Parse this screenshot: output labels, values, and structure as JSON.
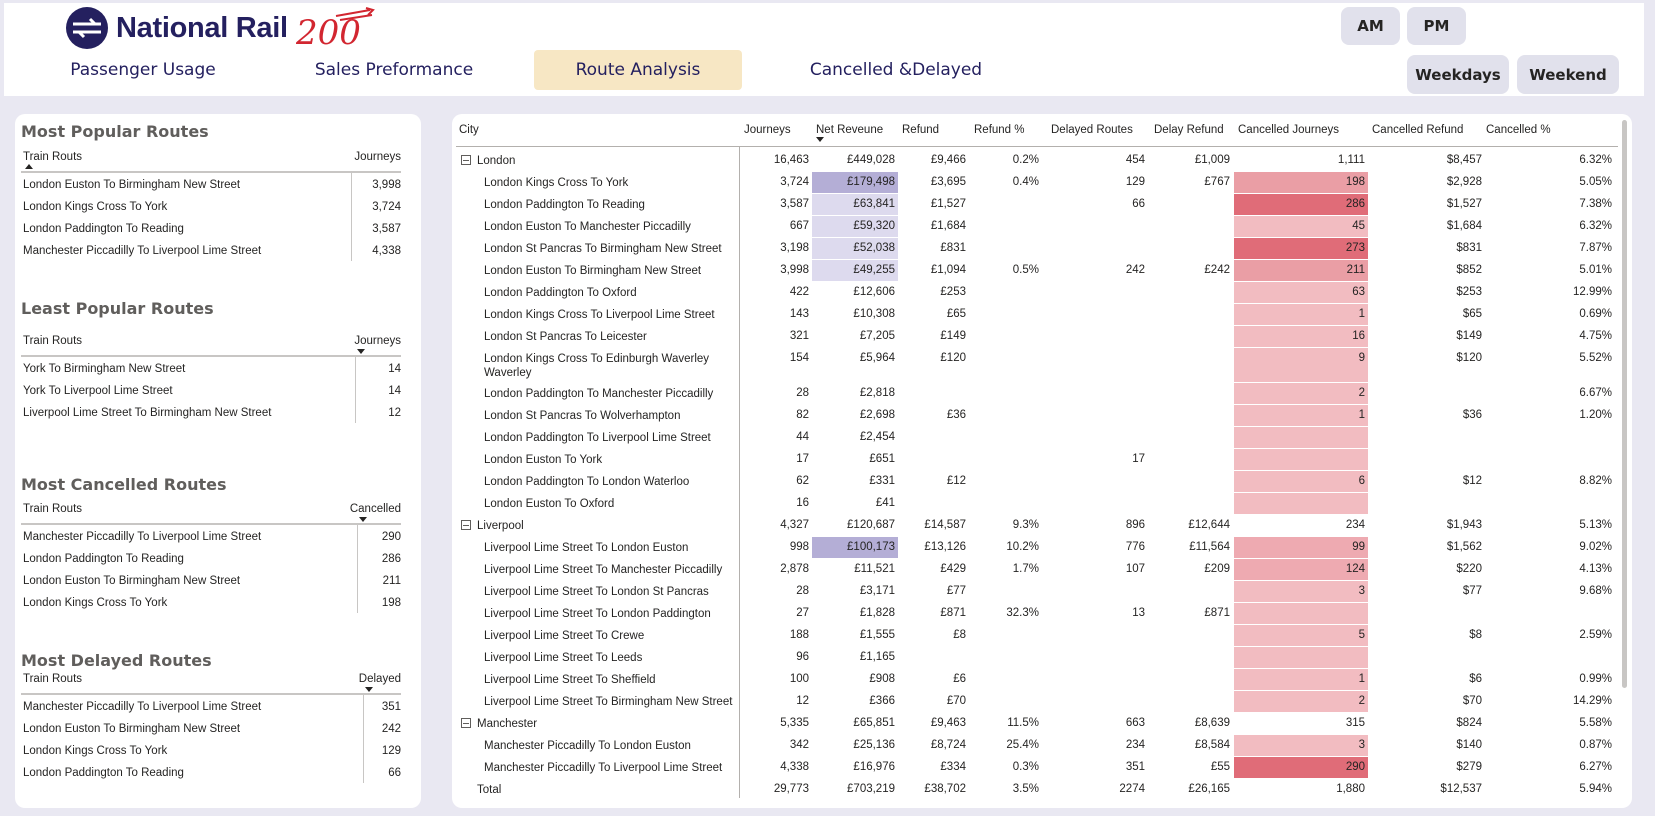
{
  "brand": {
    "name": "National Rail",
    "anniversary": "200"
  },
  "nav": {
    "tabs": [
      {
        "label": "Passenger Usage"
      },
      {
        "label": "Sales Preformance"
      },
      {
        "label": "Route Analysis"
      },
      {
        "label": "Cancelled &Delayed"
      }
    ],
    "active_tab": "Route Analysis"
  },
  "filters": {
    "am": "AM",
    "pm": "PM",
    "weekdays": "Weekdays",
    "weekend": "Weekend"
  },
  "colors": {
    "accent_tab": "#f7e7c4",
    "brand": "#24205f",
    "revenue_highlight": "#b4aed6",
    "cancelled_highlight": "#e06c78"
  },
  "left": {
    "popular": {
      "title": "Most Popular Routes",
      "col1": "Train Routs",
      "col2": "Journeys",
      "rows": [
        {
          "route": "London Euston To Birmingham New Street",
          "value": "3,998"
        },
        {
          "route": "London Kings Cross To York",
          "value": "3,724"
        },
        {
          "route": "London Paddington To Reading",
          "value": "3,587"
        },
        {
          "route": "Manchester Piccadilly To Liverpool Lime Street",
          "value": "4,338"
        }
      ]
    },
    "least": {
      "title": "Least Popular Routes",
      "col1": "Train Routs",
      "col2": "Journeys",
      "rows": [
        {
          "route": "York To Birmingham New Street",
          "value": "14"
        },
        {
          "route": "York To Liverpool Lime Street",
          "value": "14"
        },
        {
          "route": "Liverpool Lime Street To Birmingham New Street",
          "value": "12"
        }
      ]
    },
    "cancelled": {
      "title": "Most Cancelled Routes",
      "col1": "Train Routs",
      "col2": "Cancelled",
      "rows": [
        {
          "route": "Manchester Piccadilly To Liverpool Lime Street",
          "value": "290"
        },
        {
          "route": "London Paddington To Reading",
          "value": "286"
        },
        {
          "route": "London Euston To Birmingham New Street",
          "value": "211"
        },
        {
          "route": "London Kings Cross To York",
          "value": "198"
        }
      ]
    },
    "delayed": {
      "title": "Most Delayed Routes",
      "col1": "Train Routs",
      "col2": "Delayed",
      "rows": [
        {
          "route": "Manchester Piccadilly To Liverpool Lime Street",
          "value": "351"
        },
        {
          "route": "London Euston To Birmingham New Street",
          "value": "242"
        },
        {
          "route": "London Kings Cross To York",
          "value": "129"
        },
        {
          "route": "London Paddington To Reading",
          "value": "66"
        }
      ]
    }
  },
  "matrix": {
    "headers": [
      "City",
      "Journeys",
      "Net Reveune",
      "Refund",
      "Refund %",
      "Delayed Routes",
      "Delay Refund",
      "Cancelled Journeys",
      "Cancelled Refund",
      "Cancelled %"
    ],
    "rows": [
      {
        "type": "group",
        "city": "London",
        "journeys": "16,463",
        "rev": "£449,028",
        "refund": "£9,466",
        "refund_pct": "0.2%",
        "delayed": "454",
        "delay_refund": "£1,009",
        "cj": "1,111",
        "cr": "$8,457",
        "cpct": "6.32%"
      },
      {
        "type": "child",
        "city": "London Kings Cross To York",
        "journeys": "3,724",
        "rev": "£179,498",
        "refund": "£3,695",
        "refund_pct": "0.4%",
        "delayed": "129",
        "delay_refund": "£767",
        "cj": "198",
        "cr": "$2,928",
        "cpct": "5.05%",
        "rev_level": 0.4,
        "cj_level": 0.69
      },
      {
        "type": "child",
        "city": "London Paddington To Reading",
        "journeys": "3,587",
        "rev": "£63,841",
        "refund": "£1,527",
        "refund_pct": "",
        "delayed": "66",
        "delay_refund": "",
        "cj": "286",
        "cr": "$1,527",
        "cpct": "7.38%",
        "rev_level": 0.14,
        "cj_level": 0.99
      },
      {
        "type": "child",
        "city": "London Euston To Manchester Piccadilly",
        "journeys": "667",
        "rev": "£59,320",
        "refund": "£1,684",
        "refund_pct": "",
        "delayed": "",
        "delay_refund": "",
        "cj": "45",
        "cr": "$1,684",
        "cpct": "6.32%",
        "rev_level": 0.13,
        "cj_level": 0.16
      },
      {
        "type": "child",
        "city": "London St Pancras To Birmingham New Street",
        "journeys": "3,198",
        "rev": "£52,038",
        "refund": "£831",
        "refund_pct": "",
        "delayed": "",
        "delay_refund": "",
        "cj": "273",
        "cr": "$831",
        "cpct": "7.87%",
        "rev_level": 0.12,
        "cj_level": 0.94
      },
      {
        "type": "child",
        "city": "London Euston To Birmingham New Street",
        "journeys": "3,998",
        "rev": "£49,255",
        "refund": "£1,094",
        "refund_pct": "0.5%",
        "delayed": "242",
        "delay_refund": "£242",
        "cj": "211",
        "cr": "$852",
        "cpct": "5.01%",
        "rev_level": 0.11,
        "cj_level": 0.73
      },
      {
        "type": "child",
        "city": "London Paddington To Oxford",
        "journeys": "422",
        "rev": "£12,606",
        "refund": "£253",
        "refund_pct": "",
        "delayed": "",
        "delay_refund": "",
        "cj": "63",
        "cr": "$253",
        "cpct": "12.99%",
        "rev_level": 0,
        "cj_level": 0.22
      },
      {
        "type": "child",
        "city": "London Kings Cross To Liverpool Lime Street",
        "journeys": "143",
        "rev": "£10,308",
        "refund": "£65",
        "refund_pct": "",
        "delayed": "",
        "delay_refund": "",
        "cj": "1",
        "cr": "$65",
        "cpct": "0.69%",
        "rev_level": 0,
        "cj_level": 0.01
      },
      {
        "type": "child",
        "city": "London St Pancras To Leicester",
        "journeys": "321",
        "rev": "£7,205",
        "refund": "£149",
        "refund_pct": "",
        "delayed": "",
        "delay_refund": "",
        "cj": "16",
        "cr": "$149",
        "cpct": "4.75%",
        "rev_level": 0,
        "cj_level": 0.06
      },
      {
        "type": "child",
        "city": "London Kings Cross To Edinburgh Waverley Waverley",
        "journeys": "154",
        "rev": "£5,964",
        "refund": "£120",
        "refund_pct": "",
        "delayed": "",
        "delay_refund": "",
        "cj": "9",
        "cr": "$120",
        "cpct": "5.52%",
        "rev_level": 0,
        "cj_level": 0.03,
        "tall": true
      },
      {
        "type": "child",
        "city": "London Paddington To Manchester Piccadilly",
        "journeys": "28",
        "rev": "£2,818",
        "refund": "",
        "refund_pct": "",
        "delayed": "",
        "delay_refund": "",
        "cj": "2",
        "cr": "",
        "cpct": "6.67%",
        "rev_level": 0,
        "cj_level": 0.01
      },
      {
        "type": "child",
        "city": "London St Pancras To Wolverhampton",
        "journeys": "82",
        "rev": "£2,698",
        "refund": "£36",
        "refund_pct": "",
        "delayed": "",
        "delay_refund": "",
        "cj": "1",
        "cr": "$36",
        "cpct": "1.20%",
        "rev_level": 0,
        "cj_level": 0.01
      },
      {
        "type": "child",
        "city": "London Paddington To Liverpool Lime Street",
        "journeys": "44",
        "rev": "£2,454",
        "refund": "",
        "refund_pct": "",
        "delayed": "",
        "delay_refund": "",
        "cj": "",
        "cr": "",
        "cpct": "",
        "rev_level": 0,
        "cj_level": 0
      },
      {
        "type": "child",
        "city": "London Euston To York",
        "journeys": "17",
        "rev": "£651",
        "refund": "",
        "refund_pct": "",
        "delayed": "17",
        "delay_refund": "",
        "cj": "",
        "cr": "",
        "cpct": "",
        "rev_level": 0,
        "cj_level": 0
      },
      {
        "type": "child",
        "city": "London Paddington To London Waterloo",
        "journeys": "62",
        "rev": "£331",
        "refund": "£12",
        "refund_pct": "",
        "delayed": "",
        "delay_refund": "",
        "cj": "6",
        "cr": "$12",
        "cpct": "8.82%",
        "rev_level": 0,
        "cj_level": 0.02
      },
      {
        "type": "child",
        "city": "London Euston To Oxford",
        "journeys": "16",
        "rev": "£41",
        "refund": "",
        "refund_pct": "",
        "delayed": "",
        "delay_refund": "",
        "cj": "",
        "cr": "",
        "cpct": "",
        "rev_level": 0,
        "cj_level": 0
      },
      {
        "type": "group",
        "city": "Liverpool",
        "journeys": "4,327",
        "rev": "£120,687",
        "refund": "£14,587",
        "refund_pct": "9.3%",
        "delayed": "896",
        "delay_refund": "£12,644",
        "cj": "234",
        "cr": "$1,943",
        "cpct": "5.13%"
      },
      {
        "type": "child",
        "city": "Liverpool Lime Street To London Euston",
        "journeys": "998",
        "rev": "£100,173",
        "refund": "£13,126",
        "refund_pct": "10.2%",
        "delayed": "776",
        "delay_refund": "£11,564",
        "cj": "99",
        "cr": "$1,562",
        "cpct": "9.02%",
        "rev_level": 0.45,
        "cj_level": 0.34
      },
      {
        "type": "child",
        "city": "Liverpool Lime Street To Manchester Piccadilly",
        "journeys": "2,878",
        "rev": "£11,521",
        "refund": "£429",
        "refund_pct": "1.7%",
        "delayed": "107",
        "delay_refund": "£209",
        "cj": "124",
        "cr": "$220",
        "cpct": "4.13%",
        "rev_level": 0,
        "cj_level": 0.43
      },
      {
        "type": "child",
        "city": "Liverpool Lime Street To London St Pancras",
        "journeys": "28",
        "rev": "£3,171",
        "refund": "£77",
        "refund_pct": "",
        "delayed": "",
        "delay_refund": "",
        "cj": "3",
        "cr": "$77",
        "cpct": "9.68%",
        "rev_level": 0,
        "cj_level": 0.01
      },
      {
        "type": "child",
        "city": "Liverpool Lime Street To London Paddington",
        "journeys": "27",
        "rev": "£1,828",
        "refund": "£871",
        "refund_pct": "32.3%",
        "delayed": "13",
        "delay_refund": "£871",
        "cj": "",
        "cr": "",
        "cpct": "",
        "rev_level": 0,
        "cj_level": 0
      },
      {
        "type": "child",
        "city": "Liverpool Lime Street To Crewe",
        "journeys": "188",
        "rev": "£1,555",
        "refund": "£8",
        "refund_pct": "",
        "delayed": "",
        "delay_refund": "",
        "cj": "5",
        "cr": "$8",
        "cpct": "2.59%",
        "rev_level": 0,
        "cj_level": 0.02
      },
      {
        "type": "child",
        "city": "Liverpool Lime Street To Leeds",
        "journeys": "96",
        "rev": "£1,165",
        "refund": "",
        "refund_pct": "",
        "delayed": "",
        "delay_refund": "",
        "cj": "",
        "cr": "",
        "cpct": "",
        "rev_level": 0,
        "cj_level": 0
      },
      {
        "type": "child",
        "city": "Liverpool Lime Street To Sheffield",
        "journeys": "100",
        "rev": "£908",
        "refund": "£6",
        "refund_pct": "",
        "delayed": "",
        "delay_refund": "",
        "cj": "1",
        "cr": "$6",
        "cpct": "0.99%",
        "rev_level": 0,
        "cj_level": 0.01
      },
      {
        "type": "child",
        "city": "Liverpool Lime Street To Birmingham New Street",
        "journeys": "12",
        "rev": "£366",
        "refund": "£70",
        "refund_pct": "",
        "delayed": "",
        "delay_refund": "",
        "cj": "2",
        "cr": "$70",
        "cpct": "14.29%",
        "rev_level": 0,
        "cj_level": 0.01
      },
      {
        "type": "group",
        "city": "Manchester",
        "journeys": "5,335",
        "rev": "£65,851",
        "refund": "£9,463",
        "refund_pct": "11.5%",
        "delayed": "663",
        "delay_refund": "£8,639",
        "cj": "315",
        "cr": "$824",
        "cpct": "5.58%"
      },
      {
        "type": "child",
        "city": "Manchester Piccadilly To London Euston",
        "journeys": "342",
        "rev": "£25,136",
        "refund": "£8,724",
        "refund_pct": "25.4%",
        "delayed": "234",
        "delay_refund": "£8,584",
        "cj": "3",
        "cr": "$140",
        "cpct": "0.87%",
        "rev_level": 0,
        "cj_level": 0.01
      },
      {
        "type": "child",
        "city": "Manchester Piccadilly To Liverpool Lime Street",
        "journeys": "4,338",
        "rev": "£16,976",
        "refund": "£334",
        "refund_pct": "0.3%",
        "delayed": "351",
        "delay_refund": "£55",
        "cj": "290",
        "cr": "$279",
        "cpct": "6.27%",
        "rev_level": 0,
        "cj_level": 1.0
      },
      {
        "type": "total",
        "city": "Total",
        "journeys": "29,773",
        "rev": "£703,219",
        "refund": "£38,702",
        "refund_pct": "3.5%",
        "delayed": "2274",
        "delay_refund": "£26,165",
        "cj": "1,880",
        "cr": "$12,537",
        "cpct": "5.94%"
      }
    ]
  }
}
